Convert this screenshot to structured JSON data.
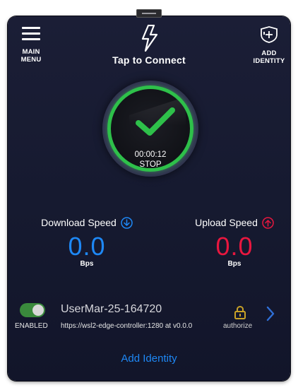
{
  "header": {
    "main_menu_label": "MAIN\nMENU",
    "add_identity_label": "ADD\nIDENTITY",
    "title": "Tap to Connect"
  },
  "connection": {
    "timer": "00:00:12",
    "action_label": "STOP",
    "status_color": "#2ec04a"
  },
  "download": {
    "label": "Download Speed",
    "value": "0.0",
    "unit": "Bps",
    "color": "#1e88f5",
    "icon": "arrow-down-circle-icon"
  },
  "upload": {
    "label": "Upload Speed",
    "value": "0.0",
    "unit": "Bps",
    "color": "#e8173f",
    "icon": "arrow-up-circle-icon"
  },
  "identity": {
    "enabled": true,
    "enabled_label": "ENABLED",
    "name": "UserMar-25-164720",
    "url": "https://wsl2-edge-controller:1280 at v0.0.0",
    "auth_label": "authorize",
    "lock_color": "#c9a227"
  },
  "footer": {
    "add_identity_link": "Add Identity",
    "link_color": "#1e88f5"
  }
}
